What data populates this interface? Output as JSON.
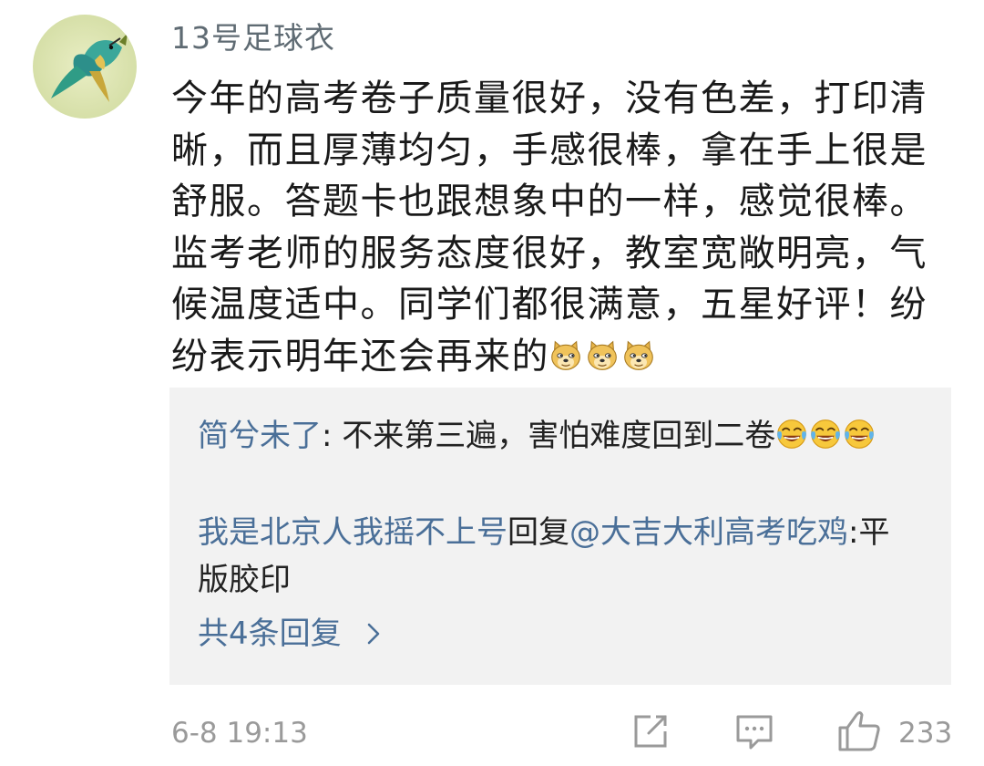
{
  "comment": {
    "username": "13号足球衣",
    "text": "今年的高考卷子质量很好，没有色差，打印清晰，而且厚薄均匀，手感很棒，拿在手上很是舒服。答题卡也跟想象中的一样，感觉很棒。监考老师的服务态度很好，教室宽敞明亮，气候温度适中。同学们都很满意，五星好评！纷纷表示明年还会再来的",
    "emoji_icon": "doge-emoji-icon",
    "emoji_count": 3,
    "timestamp": "6-8 19:13",
    "like_count": "233"
  },
  "replies": [
    {
      "user": "简兮未了",
      "separator": ":",
      "text": " 不来第三遍，害怕难度回到二卷",
      "emoji_icon": "laughing-tears-emoji-icon",
      "emoji_count": 3
    },
    {
      "user": "我是北京人我摇不上号",
      "action": "回复",
      "mention": "@大吉大利高考吃鸡",
      "separator": ":",
      "text": "平版胶印"
    }
  ],
  "more_replies_label": "共4条回复",
  "colors": {
    "link_blue": "#4a6f98",
    "meta_gray": "#9a9a9a",
    "reply_bg": "#f2f2f2"
  },
  "icons": {
    "forward": "share-square-icon",
    "reply": "comment-bubble-icon",
    "like": "thumbs-up-icon",
    "chevron": "chevron-right-icon"
  }
}
